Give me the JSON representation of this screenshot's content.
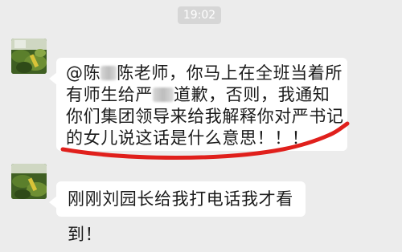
{
  "time_stamp": "19:02",
  "messages": [
    {
      "lines": {
        "l1_pre": "@陈",
        "l1_post": "陈老师，你马上在全班当着所",
        "l2_pre": "有师生给严",
        "l2_post": "道歉，否则，我通知",
        "l3": "你们集团领导来给我解释你对严书记",
        "l4": "的女儿说这话是什么意思！！！"
      }
    },
    {
      "text": "刚刚刘园长给我打电话我才看到！"
    }
  ],
  "annotation_color": "#e0201c"
}
